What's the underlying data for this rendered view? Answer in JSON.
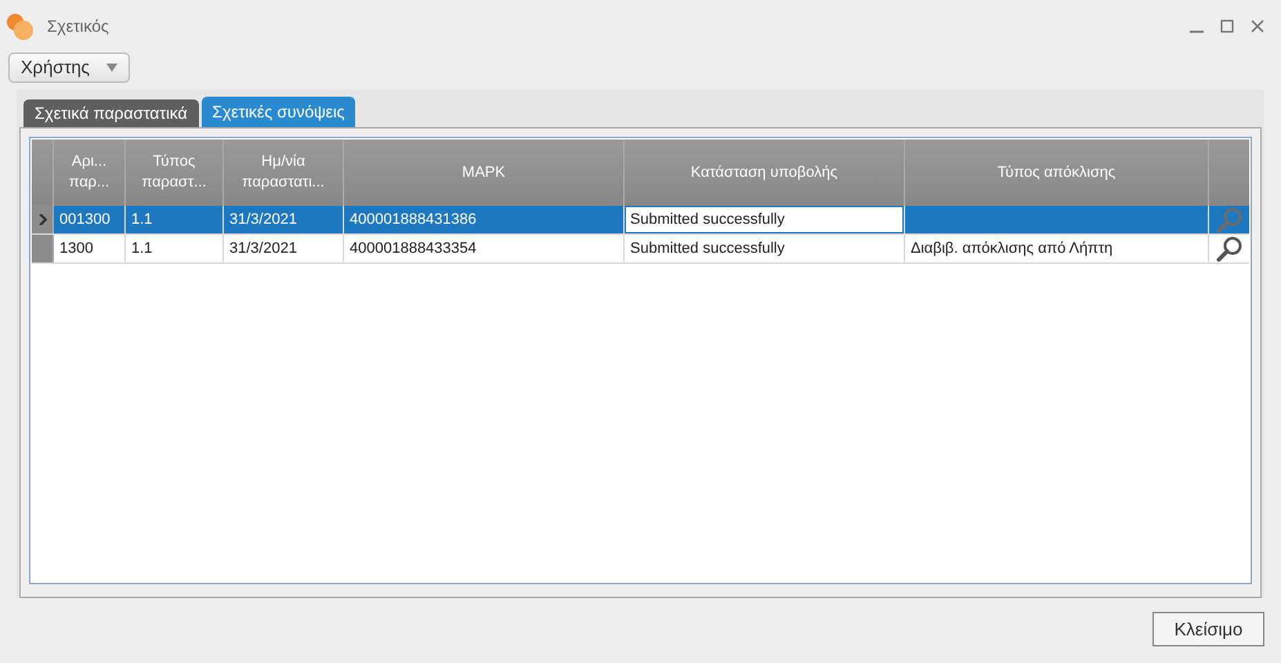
{
  "window": {
    "title": "Σχετικός"
  },
  "user_menu": {
    "label": "Χρήστης"
  },
  "tabs": [
    {
      "label": "Σχετικά παραστατικά",
      "selected": false
    },
    {
      "label": "Σχετικές συνόψεις",
      "selected": true
    }
  ],
  "table": {
    "columns": [
      "Αρι... παρ...",
      "Τύπος παραστ...",
      "Ημ/νία παραστατι...",
      "ΜΑΡΚ",
      "Κατάσταση υποβολής",
      "Τύπος απόκλισης"
    ],
    "rows": [
      {
        "selected": true,
        "cells": [
          {
            "text": "001300",
            "current": false
          },
          {
            "text": "1.1",
            "current": false
          },
          {
            "text": "31/3/2021",
            "current": false
          },
          {
            "text": "400001888431386",
            "current": false
          },
          {
            "text": "Submitted successfully",
            "current": true
          },
          {
            "text": "",
            "current": false
          }
        ]
      },
      {
        "selected": false,
        "cells": [
          {
            "text": "1300",
            "current": false
          },
          {
            "text": "1.1",
            "current": false
          },
          {
            "text": "31/3/2021",
            "current": false
          },
          {
            "text": "400001888433354",
            "current": false
          },
          {
            "text": "Submitted successfully",
            "current": false
          },
          {
            "text": "Διαβιβ. απόκλισης από Λήπτη",
            "current": false
          }
        ]
      }
    ]
  },
  "close_button": {
    "label": "Κλείσιμο"
  }
}
